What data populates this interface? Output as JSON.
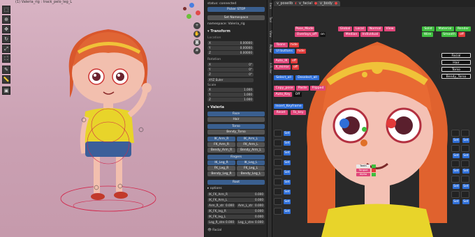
{
  "viewport": {
    "title": "(1) Valeria_rig : track_pelo_leg_L",
    "tools": [
      "select-icon",
      "cursor-icon",
      "move-icon",
      "rotate-icon",
      "scale-icon",
      "transform-icon",
      "annotate-icon",
      "measure-icon",
      "add-cube-icon"
    ],
    "nav": [
      "zoom-icon",
      "hand-icon",
      "camera-icon",
      "grid-icon"
    ]
  },
  "npanel": {
    "status": "status: connected",
    "picker_stop": "Picker STOP",
    "set_namespace": "Set Namespace",
    "namespace": "namespace: Valeria_rig",
    "transform_header": "Transform",
    "location_label": "Location",
    "loc": [
      [
        "X",
        "0.00000"
      ],
      [
        "Y",
        "0.00000"
      ],
      [
        "Z",
        "0.00000"
      ]
    ],
    "rotation_label": "Rotation",
    "rot": [
      [
        "X",
        "0°"
      ],
      [
        "Y",
        "0°"
      ],
      [
        "Z",
        "0°"
      ]
    ],
    "euler": "XYZ Euler",
    "scale_label": "Scale",
    "scale": [
      [
        "X",
        "1.000"
      ],
      [
        "Y",
        "1.000"
      ],
      [
        "Z",
        "1.000"
      ]
    ],
    "valeria_header": "Valeria",
    "face": "Face",
    "hair": "Hair",
    "torso": "Torso",
    "bendy_torso": "Bendy_Torso",
    "arms": [
      [
        "IK_Arm_R",
        "IK_Arm_L"
      ],
      [
        "FK_Arm_R",
        "FK_Arm_L"
      ],
      [
        "Bendy_Arm_R",
        "Bendy_Arm_L"
      ]
    ],
    "fingers": "Fingers",
    "legs": [
      [
        "IK_Leg_R",
        "IK_Leg_L"
      ],
      [
        "FK_Leg_R",
        "FK_Leg_L"
      ],
      [
        "Bendy_Leg_R",
        "Bendy_Leg_L"
      ]
    ],
    "root": "Root",
    "options": "options",
    "opt_rows": [
      [
        "IK_FK_Arm_R",
        "0.000"
      ],
      [
        "IK_FK_Arm_L",
        "0.000"
      ],
      [
        "Arm_R_str",
        "0.000",
        "Arm_L_str",
        "0.000"
      ],
      [
        "IK_FK_leg_R",
        "0.000"
      ],
      [
        "IK_FK_leg_L",
        "0.000"
      ],
      [
        "Leg_R_stre",
        "0.000",
        "Leg_L_stre",
        "0.000"
      ]
    ],
    "facial": "Facial"
  },
  "vtabs": [
    "Item",
    "Tool",
    "View",
    "Picker",
    "X-Picker"
  ],
  "picker": {
    "tabs": [
      "v_poselib",
      "v_facial",
      "v_body"
    ],
    "pose_mode": "Pose_Mode",
    "overlays_off": "Overlays_off",
    "on": "on",
    "toggle_buttons": [
      "Global",
      "Local",
      "Normal",
      "View"
    ],
    "median": "Median",
    "individual": "Individual",
    "toons": "Toons",
    "hide1": "hide",
    "ui_buttons": "UI buttons",
    "hide2": "hide",
    "auto_ik": "Auto_IK",
    "off1": "off",
    "x_mirror": "X_mirror",
    "off2": "off",
    "select_all": "Select_all",
    "deselect_all": "Deselect_all",
    "copy_pose": "Copy_pose",
    "paste": "Paste",
    "flipped": "Flipped",
    "auto_key": "Auto_Key",
    "off3": "Off",
    "insert_keyframe": "Insert_Keyframe",
    "reset": "Reset",
    "to_key": "To_key",
    "shading": [
      "Solid",
      "Material",
      "Render"
    ],
    "wire": "Wire",
    "smooth": "Smooth",
    "off4": "off",
    "right_list": [
      "Facial",
      "Hair",
      "Torso",
      "Bendy_Torso"
    ],
    "set": "Set",
    "teeth": "Teeth",
    "tongue": "Tongue",
    "alpha": "Alpha"
  }
}
